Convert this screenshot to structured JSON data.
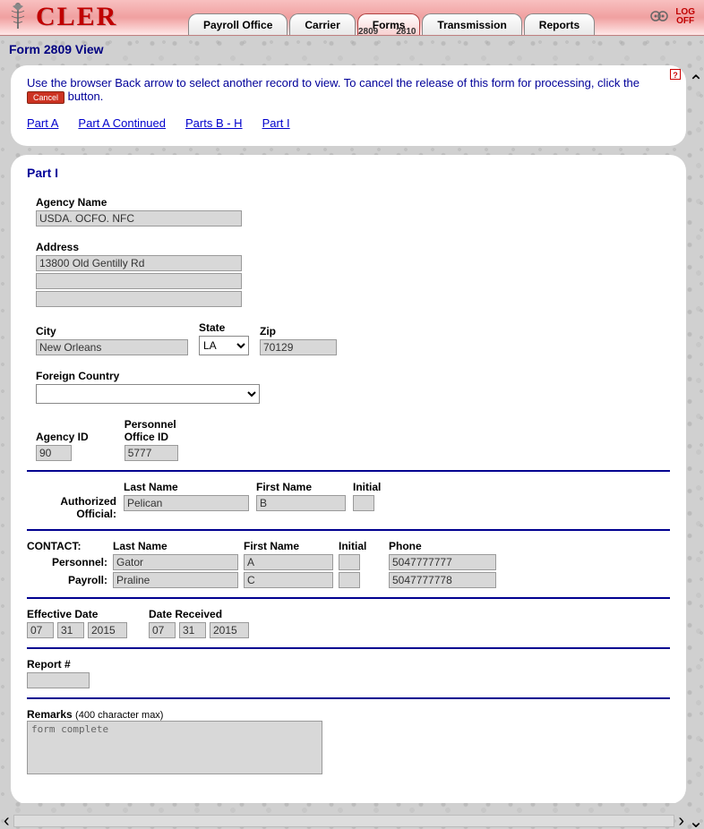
{
  "app": {
    "logo_text": "CLER",
    "tabs": [
      "Payroll Office",
      "Carrier",
      "Forms",
      "Transmission",
      "Reports"
    ],
    "active_tab": "Forms",
    "subtabs": [
      "2809",
      "2810"
    ],
    "logoff_l1": "LOG",
    "logoff_l2": "OFF"
  },
  "page": {
    "title": "Form 2809 View",
    "help": "?",
    "instr_pre": "Use the browser Back arrow to select another record to view.  To cancel the release of this form for processing, click the ",
    "cancel_label": "Cancel",
    "instr_post": " button.",
    "anchors": [
      "Part A",
      "Part A Continued",
      "Parts B - H",
      "Part I"
    ]
  },
  "partI": {
    "title": "Part I",
    "agency_name_label": "Agency Name",
    "agency_name": "USDA. OCFO. NFC",
    "address_label": "Address",
    "address1": "13800 Old Gentilly Rd",
    "address2": "",
    "address3": "",
    "city_label": "City",
    "city": "New Orleans",
    "state_label": "State",
    "state": "LA",
    "zip_label": "Zip",
    "zip": "70129",
    "foreign_label": "Foreign Country",
    "foreign": "",
    "agency_id_label": "Agency ID",
    "agency_id": "90",
    "poi_label_l1": "Personnel",
    "poi_label_l2": "Office ID",
    "poi": "5777",
    "auth_label_l1": "Authorized",
    "auth_label_l2": "Official:",
    "last_name_label": "Last Name",
    "first_name_label": "First Name",
    "initial_label": "Initial",
    "phone_label": "Phone",
    "auth_last": "Pelican",
    "auth_first": "B",
    "auth_init": "",
    "contact_label": "CONTACT:",
    "contact_personnel_label": "Personnel:",
    "contact_payroll_label": "Payroll:",
    "pers_last": "Gator",
    "pers_first": "A",
    "pers_init": "",
    "pers_phone": "5047777777",
    "pay_last": "Praline",
    "pay_first": "C",
    "pay_init": "",
    "pay_phone": "5047777778",
    "eff_date_label": "Effective Date",
    "recv_date_label": "Date Received",
    "eff_mm": "07",
    "eff_dd": "31",
    "eff_yy": "2015",
    "recv_mm": "07",
    "recv_dd": "31",
    "recv_yy": "2015",
    "report_label": "Report #",
    "report": "",
    "remarks_label": "Remarks",
    "remarks_hint": "(400 character max)",
    "remarks": "form complete"
  }
}
